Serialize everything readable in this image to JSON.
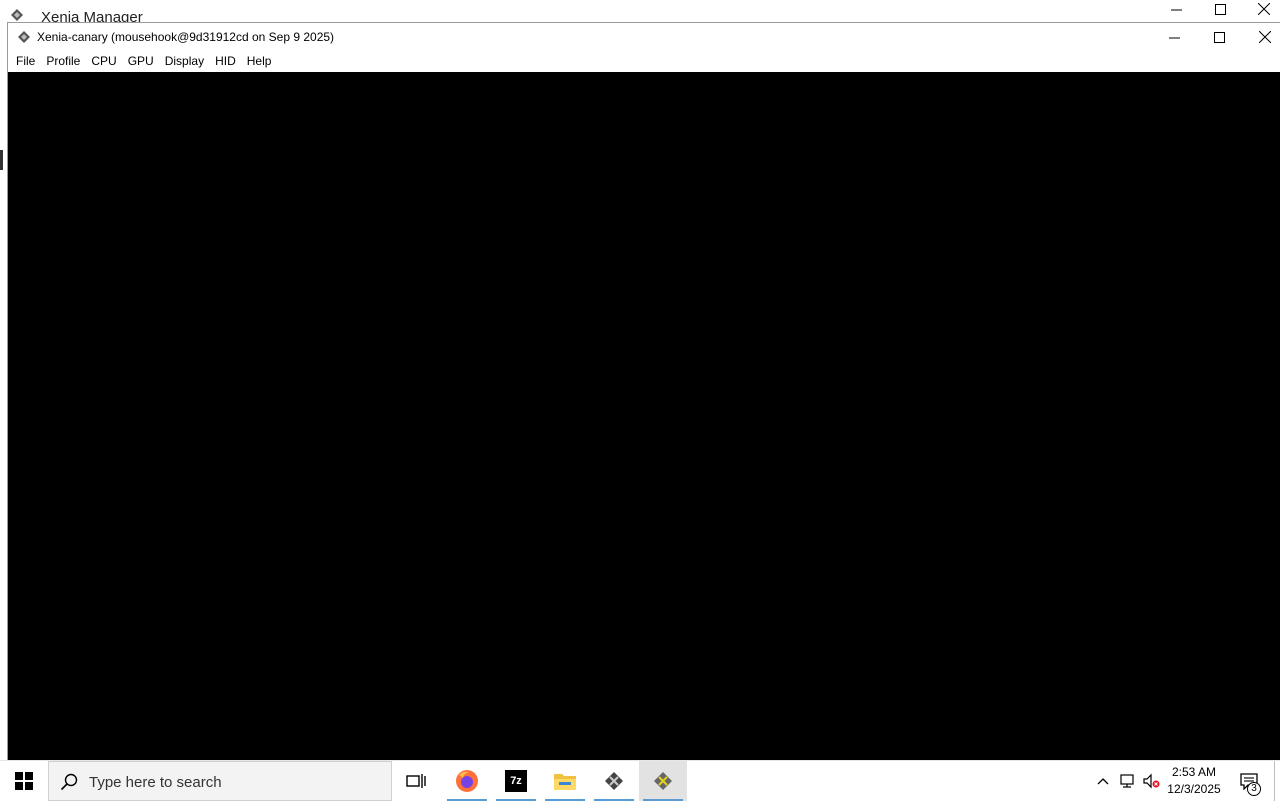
{
  "background_window": {
    "title": "Xenia Manager",
    "icon": "xenia-icon"
  },
  "window": {
    "title": "Xenia-canary (mousehook@9d31912cd on Sep  9 2025)",
    "icon": "xenia-icon",
    "menu": [
      "File",
      "Profile",
      "CPU",
      "GPU",
      "Display",
      "HID",
      "Help"
    ]
  },
  "taskbar": {
    "search_placeholder": "Type here to search",
    "apps": [
      {
        "name": "task-view",
        "icon": "task-view-icon"
      },
      {
        "name": "firefox",
        "icon": "firefox-icon"
      },
      {
        "name": "7zip",
        "icon": "7zip-icon",
        "label": "7z"
      },
      {
        "name": "file-explorer",
        "icon": "folder-icon"
      },
      {
        "name": "xenia-manager",
        "icon": "xenia-icon"
      },
      {
        "name": "xenia-canary",
        "icon": "xenia-canary-icon"
      }
    ],
    "clock": {
      "time": "2:53 AM",
      "date": "12/3/2025"
    },
    "notification_count": "3"
  },
  "colors": {
    "viewport": "#000000",
    "taskbar": "#ffffff",
    "accent": "#5b9bd5"
  }
}
